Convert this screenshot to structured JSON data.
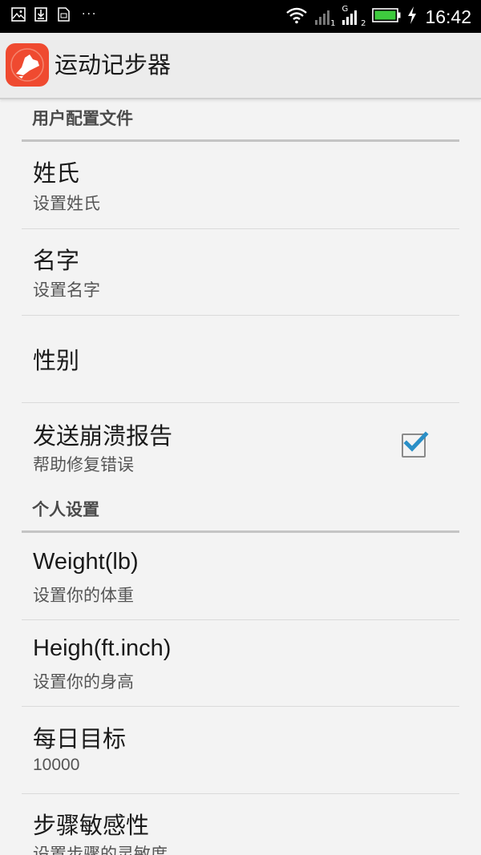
{
  "status_bar": {
    "time": "16:42",
    "left_icons": [
      "image-icon",
      "download-icon",
      "sim-icon"
    ],
    "more": "···",
    "network_g": "G",
    "sim1": "1",
    "sim2": "2"
  },
  "app_bar": {
    "title": "运动记步器",
    "icon": "shoe-icon",
    "icon_color": "#ef4a30"
  },
  "sections": [
    {
      "header": "用户配置文件",
      "items": [
        {
          "title": "姓氏",
          "summary": "设置姓氏"
        },
        {
          "title": "名字",
          "summary": "设置名字"
        },
        {
          "title": "性别",
          "summary": ""
        },
        {
          "title": "发送崩溃报告",
          "summary": "帮助修复错误",
          "checkbox": true
        }
      ]
    },
    {
      "header": "个人设置",
      "items": [
        {
          "title": "Weight(lb)",
          "summary": "设置你的体重"
        },
        {
          "title": "Heigh(ft.inch)",
          "summary": "设置你的身高"
        },
        {
          "title": "每日目标",
          "summary": "10000"
        },
        {
          "title": "步骤敏感性",
          "summary": "设置步骤的灵敏度"
        }
      ]
    }
  ],
  "colors": {
    "checkbox_check": "#2a8fc7",
    "battery": "#3ecb3e"
  }
}
